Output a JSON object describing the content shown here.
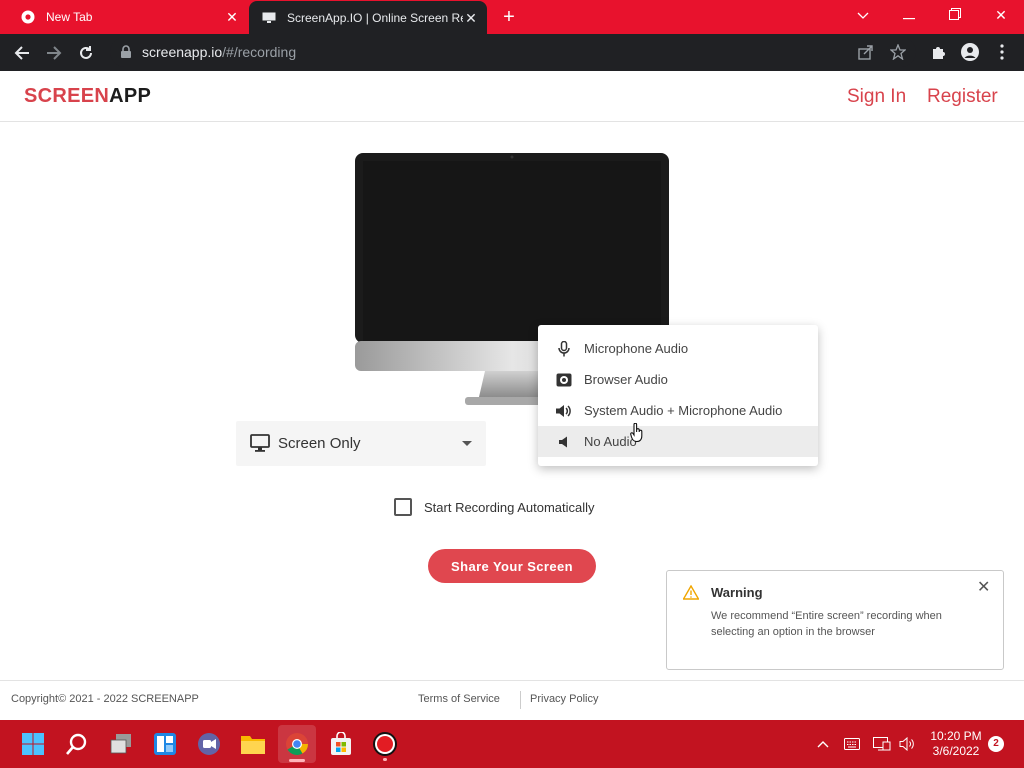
{
  "browser": {
    "tabs": [
      {
        "title": "New Tab",
        "active": false
      },
      {
        "title": "ScreenApp.IO | Online Screen Rec",
        "active": true
      }
    ],
    "new_tab_label": "+",
    "url_host": "screenapp.io",
    "url_path": "/#/recording"
  },
  "header": {
    "logo_part1": "SCREEN",
    "logo_part2": "APP",
    "sign_in": "Sign In",
    "register": "Register"
  },
  "recorder": {
    "screen_select_value": "Screen Only",
    "audio_options": [
      {
        "label": "Microphone Audio",
        "icon": "microphone-icon"
      },
      {
        "label": "Browser Audio",
        "icon": "browser-audio-icon"
      },
      {
        "label": "System Audio + Microphone Audio",
        "icon": "speaker-icon"
      },
      {
        "label": "No Audio",
        "icon": "mute-speaker-icon",
        "hovered": true
      }
    ],
    "auto_record_label": "Start Recording Automatically",
    "share_button": "Share Your Screen"
  },
  "toast": {
    "title": "Warning",
    "message": "We recommend “Entire screen” recording when selecting an option in the browser"
  },
  "footer": {
    "copyright": "Copyright©   2021 - 2022 SCREENAPP",
    "terms": "Terms of Service",
    "privacy": "Privacy Policy"
  },
  "taskbar": {
    "time": "10:20 PM",
    "date": "3/6/2022",
    "notifications": "2"
  },
  "colors": {
    "brand_red": "#d8434c",
    "button_red": "#e0474f",
    "chrome_tab_red": "#e8122d",
    "taskbar_red": "#c21320",
    "warning_amber": "#f0a500"
  }
}
